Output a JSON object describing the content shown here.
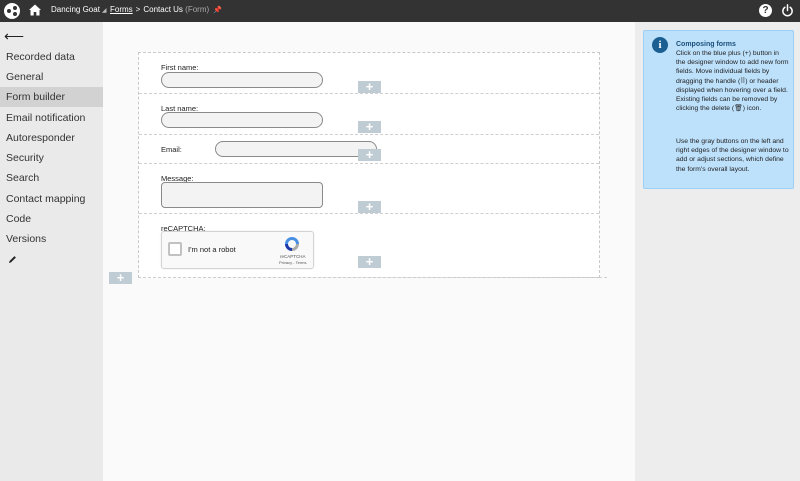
{
  "topbar": {
    "site": "Dancing Goat",
    "breadcrumb_link": "Forms",
    "breadcrumb_separator": ">",
    "page_title": "Contact Us",
    "page_type": "(Form)",
    "help": "?"
  },
  "sidebar": {
    "items": [
      {
        "label": "Recorded data"
      },
      {
        "label": "General"
      },
      {
        "label": "Form builder"
      },
      {
        "label": "Email notification"
      },
      {
        "label": "Autoresponder"
      },
      {
        "label": "Security"
      },
      {
        "label": "Search"
      },
      {
        "label": "Contact mapping"
      },
      {
        "label": "Code"
      },
      {
        "label": "Versions"
      }
    ],
    "active": "Form builder"
  },
  "form": {
    "first_name_label": "First name:",
    "last_name_label": "Last name:",
    "email_label": "Email:",
    "message_label": "Message:",
    "recaptcha_label": "reCAPTCHA:",
    "captcha_text": "I'm not a robot",
    "captcha_brand": "reCAPTCHA",
    "captcha_terms": "Privacy - Terms",
    "plus": "+"
  },
  "info": {
    "icon": "i",
    "title": "Composing forms",
    "p1": "Click on the blue plus (+) button in the designer window to add new form fields. Move individual fields by dragging the handle (⠿) or header displayed when hovering over a field. Existing fields can be removed by clicking the delete (🗑) icon.",
    "p2": "Use the gray buttons on the left and right edges of the designer window to add or adjust sections, which define the form's overall layout."
  }
}
